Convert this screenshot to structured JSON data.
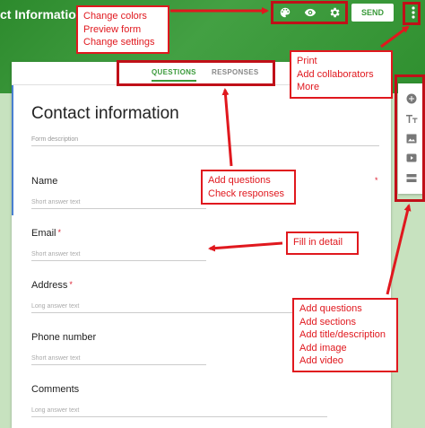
{
  "header": {
    "title": "ct Information",
    "send_label": "SEND"
  },
  "tabs": {
    "questions": "QUESTIONS",
    "responses": "RESPONSES"
  },
  "form": {
    "title": "Contact information",
    "description_placeholder": "Form description",
    "questions": [
      {
        "label": "Name",
        "required": false,
        "hint": "Short answer text"
      },
      {
        "label": "Email",
        "required": true,
        "hint": "Short answer text"
      },
      {
        "label": "Address",
        "required": true,
        "hint": "Long answer text"
      },
      {
        "label": "Phone number",
        "required": false,
        "hint": "Short answer text"
      },
      {
        "label": "Comments",
        "required": false,
        "hint": "Long answer text"
      }
    ],
    "required_mark": "*"
  },
  "callouts": {
    "toolbar": [
      "Change colors",
      "Preview form",
      "Change settings"
    ],
    "more_menu": [
      "Print",
      "Add collaborators",
      "More"
    ],
    "tabs": [
      "Add questions",
      "Check responses"
    ],
    "fill": [
      "Fill in detail"
    ],
    "sidebar": [
      "Add questions",
      "Add sections",
      "Add title/description",
      "Add image",
      "Add video"
    ]
  },
  "icons": {
    "toolbar": [
      "palette-icon",
      "eye-icon",
      "gear-icon"
    ],
    "more": "more-vert-icon",
    "sidebar": [
      "add-circle-icon",
      "title-icon",
      "image-icon",
      "video-icon",
      "section-icon"
    ]
  },
  "colors": {
    "header_green": "#43a043",
    "accent_green": "#3a9a3a",
    "callout_red": "#e0181e",
    "active_blue": "#4a7fd1",
    "required_red": "#d23"
  }
}
